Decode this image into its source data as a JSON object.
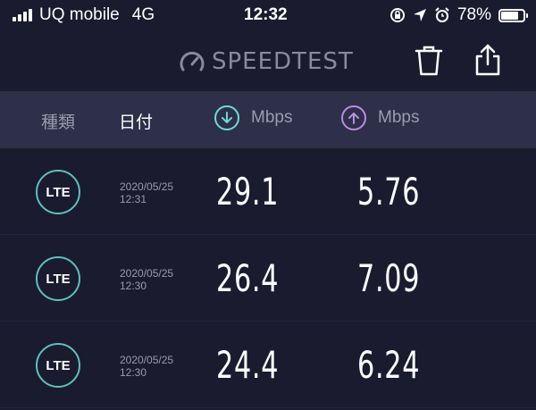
{
  "status_bar": {
    "carrier": "UQ mobile",
    "network": "4G",
    "time": "12:32",
    "battery_percent": "78%",
    "battery_level": 0.78
  },
  "app": {
    "logo_text": "SPEEDTEST"
  },
  "table": {
    "headers": {
      "type": "種類",
      "date": "日付",
      "download_unit": "Mbps",
      "upload_unit": "Mbps"
    },
    "rows": [
      {
        "type": "LTE",
        "date": "2020/05/25",
        "time": "12:31",
        "download": "29.1",
        "upload": "5.76"
      },
      {
        "type": "LTE",
        "date": "2020/05/25",
        "time": "12:30",
        "download": "26.4",
        "upload": "7.09"
      },
      {
        "type": "LTE",
        "date": "2020/05/25",
        "time": "12:30",
        "download": "24.4",
        "upload": "6.24"
      }
    ]
  },
  "colors": {
    "background": "#1a1b2f",
    "header_bg": "#2e2f48",
    "download_accent": "#6fd9d6",
    "upload_accent": "#b88de0",
    "lte_ring": "#5fbfbd"
  }
}
